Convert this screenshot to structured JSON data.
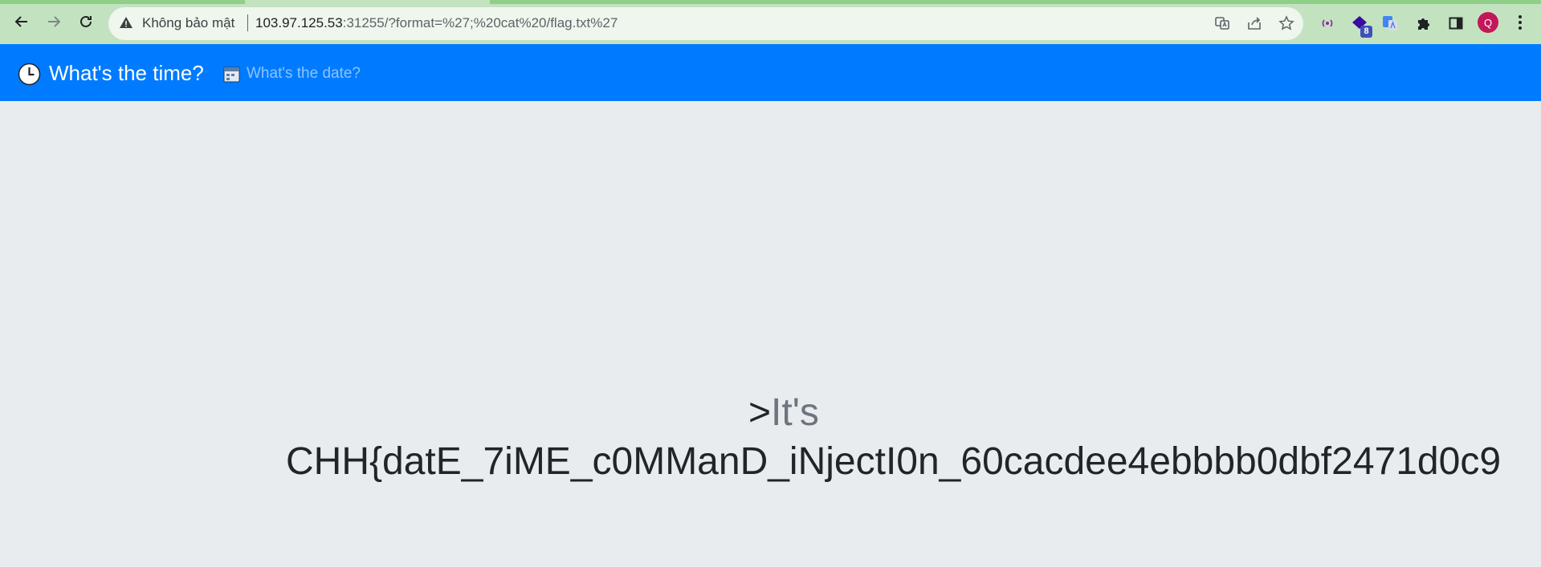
{
  "browser": {
    "security_label": "Không bảo mật",
    "url_host": "103.97.125.53",
    "url_rest": ":31255/?format=%27;%20cat%20/flag.txt%27",
    "icons": {
      "back": "arrow-left-icon",
      "forward": "arrow-right-icon",
      "reload": "reload-icon",
      "warning": "warning-triangle-icon",
      "translate": "translate-icon",
      "share": "share-icon",
      "bookmark": "star-icon",
      "extensions": "puzzle-icon",
      "side_panel": "side-panel-icon",
      "menu": "kebab-menu-icon"
    },
    "extension_badge": "8",
    "profile_initial": "Q",
    "colors": {
      "chrome_bg": "#c3e3c0",
      "omnibox_bg": "#eef6ed",
      "avatar_bg": "#c2185b"
    }
  },
  "navbar": {
    "brand": "What's the time?",
    "date_link": "What's the date?",
    "colors": {
      "bg": "#007bff"
    }
  },
  "content": {
    "prompt": ">",
    "label": "It's",
    "flag": "CHH{datE_7iME_c0MManD_iNjectI0n_60cacdee4ebbbb0dbf2471d0c9"
  }
}
